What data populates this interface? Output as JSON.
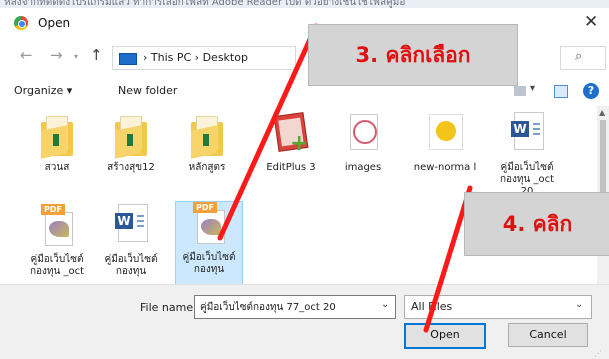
{
  "background_strip": "หลังจากที่ติดตั้งโปรแกรมแล้ว ทำการเลือกไฟล์ที่ Adobe Reader เปิด ตัวอย่างเช่นใช้ไฟล์คู่มือ",
  "window": {
    "title": "Open",
    "close_glyph": "✕"
  },
  "nav": {
    "back": "←",
    "forward": "→",
    "up": "↑",
    "breadcrumbs": "›  This PC  ›  Desktop",
    "search_glyph": "⌕"
  },
  "toolbar": {
    "organize": "Organize ▾",
    "new_folder": "New folder",
    "help": "?"
  },
  "files": [
    {
      "name": "สวนส",
      "icon": "folder-icon"
    },
    {
      "name": "สร้างสุข12",
      "icon": "folder-icon"
    },
    {
      "name": "หลักสูตร",
      "icon": "folder-icon"
    },
    {
      "name": "EditPlus 3",
      "icon": "editplus-shortcut-icon"
    },
    {
      "name": "images",
      "icon": "image-folder-icon"
    },
    {
      "name": "new-norma l",
      "icon": "badge-image-icon"
    },
    {
      "name": "คู่มือเว็บไซต์ กองทุน _oct 20",
      "icon": "word-doc-icon"
    },
    {
      "name": "คู่มือเว็บไซต์ กองทุน _oct",
      "icon": "pdf-icon"
    },
    {
      "name": "คู่มือเว็บไซต์ กองทุน",
      "icon": "word-doc-icon"
    },
    {
      "name": "คู่มือเว็บไซต์ กองทุน",
      "icon": "pdf-icon",
      "selected": true
    }
  ],
  "footer": {
    "file_name_label": "File name:",
    "file_name_value": "คู่มือเว็บไซต์กองทุน 77_oct 20",
    "file_type_value": "All Files",
    "open_label": "Open",
    "cancel_label": "Cancel"
  },
  "annotations": {
    "step3": "3. คลิกเลือก",
    "step4": "4. คลิก",
    "arrow_color": "#ff1a1a"
  }
}
